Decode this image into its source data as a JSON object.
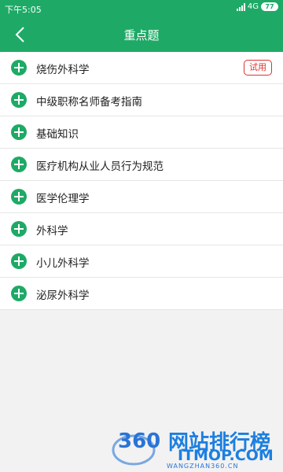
{
  "status_bar": {
    "time": "下午5:05",
    "network": "4G",
    "battery": "77"
  },
  "nav": {
    "back_icon": "chevron-left-icon",
    "title": "重点题"
  },
  "list": {
    "items": [
      {
        "label": "烧伤外科学",
        "badge": "试用"
      },
      {
        "label": "中级职称名师备考指南"
      },
      {
        "label": "基础知识"
      },
      {
        "label": "医疗机构从业人员行为规范"
      },
      {
        "label": "医学伦理学"
      },
      {
        "label": "外科学"
      },
      {
        "label": "小儿外科学"
      },
      {
        "label": "泌尿外科学"
      }
    ]
  },
  "watermark": {
    "logo": "360",
    "site_cn": "网站排行榜",
    "site_en": "ITMOP.COM",
    "domain": "WANGZHAN360.CN"
  },
  "colors": {
    "brand": "#1eaa66",
    "badge": "#e03030",
    "background": "#f2f2f2"
  }
}
